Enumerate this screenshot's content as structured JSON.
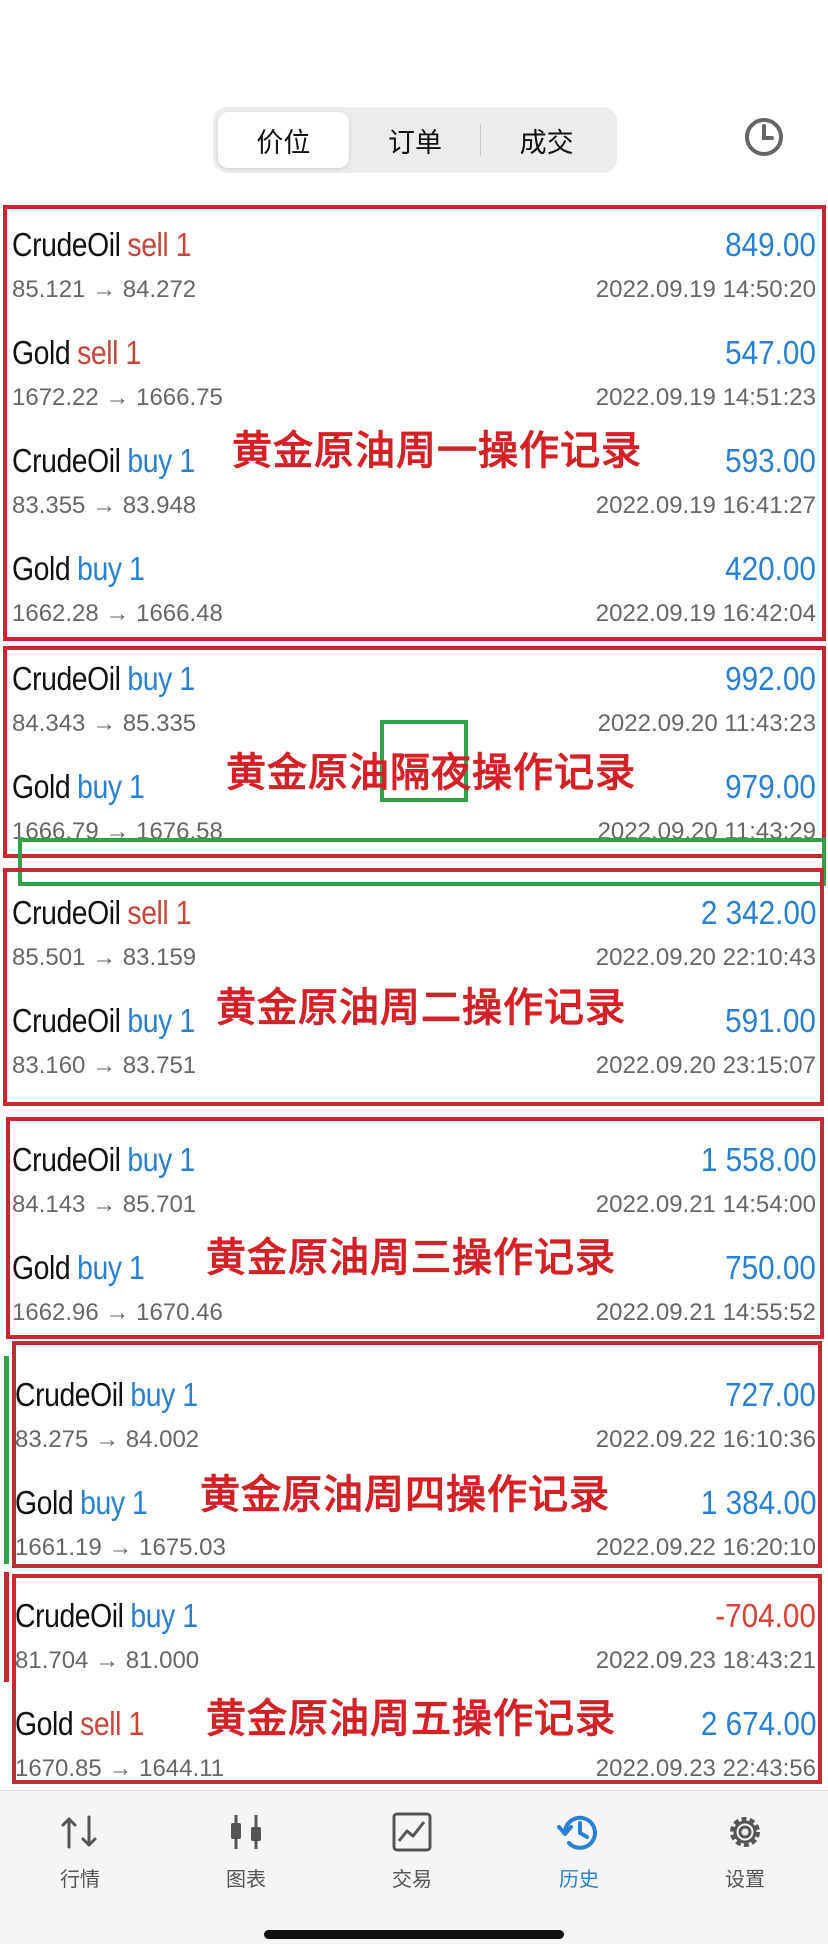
{
  "tabs": [
    "价位",
    "订单",
    "成交"
  ],
  "active_tab": 0,
  "header_icon": "clock-history-icon",
  "rows": [
    {
      "symbol": "CrudeOil",
      "side": "sell",
      "lots": "1",
      "profit": "849.00",
      "prices": "85.121 → 84.272",
      "time": "2022.09.19 14:50:20"
    },
    {
      "symbol": "Gold",
      "side": "sell",
      "lots": "1",
      "profit": "547.00",
      "prices": "1672.22 → 1666.75",
      "time": "2022.09.19 14:51:23"
    },
    {
      "symbol": "CrudeOil",
      "side": "buy",
      "lots": "1",
      "profit": "593.00",
      "prices": "83.355 → 83.948",
      "time": "2022.09.19 16:41:27"
    },
    {
      "symbol": "Gold",
      "side": "buy",
      "lots": "1",
      "profit": "420.00",
      "prices": "1662.28 → 1666.48",
      "time": "2022.09.19 16:42:04"
    },
    {
      "symbol": "CrudeOil",
      "side": "buy",
      "lots": "1",
      "profit": "992.00",
      "prices": "84.343 → 85.335",
      "time": "2022.09.20 11:43:23"
    },
    {
      "symbol": "Gold",
      "side": "buy",
      "lots": "1",
      "profit": "979.00",
      "prices": "1666.79 → 1676.58",
      "time": "2022.09.20 11:43:29"
    },
    {
      "symbol": "CrudeOil",
      "side": "sell",
      "lots": "1",
      "profit": "2 342.00",
      "prices": "85.501 → 83.159",
      "time": "2022.09.20 22:10:43"
    },
    {
      "symbol": "CrudeOil",
      "side": "buy",
      "lots": "1",
      "profit": "591.00",
      "prices": "83.160 → 83.751",
      "time": "2022.09.20 23:15:07"
    },
    {
      "symbol": "CrudeOil",
      "side": "buy",
      "lots": "1",
      "profit": "1 558.00",
      "prices": "84.143 → 85.701",
      "time": "2022.09.21 14:54:00"
    },
    {
      "symbol": "Gold",
      "side": "buy",
      "lots": "1",
      "profit": "750.00",
      "prices": "1662.96 → 1670.46",
      "time": "2022.09.21 14:55:52"
    },
    {
      "symbol": "CrudeOil",
      "side": "buy",
      "lots": "1",
      "profit": "727.00",
      "prices": "83.275 → 84.002",
      "time": "2022.09.22 16:10:36"
    },
    {
      "symbol": "Gold",
      "side": "buy",
      "lots": "1",
      "profit": "1 384.00",
      "prices": "1661.19 → 1675.03",
      "time": "2022.09.22 16:20:10"
    },
    {
      "symbol": "CrudeOil",
      "side": "buy",
      "lots": "1",
      "profit": "-704.00",
      "prices": "81.704 → 81.000",
      "time": "2022.09.23 18:43:21"
    },
    {
      "symbol": "Gold",
      "side": "sell",
      "lots": "1",
      "profit": "2 674.00",
      "prices": "1670.85 → 1644.11",
      "time": "2022.09.23 22:43:56"
    }
  ],
  "annotations": {
    "mon": "黄金原油周一操作记录",
    "overnight_pre": "黄金原油",
    "overnight_hl": "隔夜",
    "overnight_post": "操作记录",
    "tue": "黄金原油周二操作记录",
    "wed": "黄金原油周三操作记录",
    "thu": "黄金原油周四操作记录",
    "fri": "黄金原油周五操作记录"
  },
  "colors": {
    "sell": "#c8453a",
    "buy": "#2a7fd0",
    "loss": "#d8403a",
    "annotation": "#d42027",
    "highlight_green": "#2fa34a"
  },
  "tabbar": [
    {
      "label": "行情",
      "icon": "quotes-arrows-icon"
    },
    {
      "label": "图表",
      "icon": "candlestick-chart-icon"
    },
    {
      "label": "交易",
      "icon": "trade-chart-icon"
    },
    {
      "label": "历史",
      "icon": "history-clock-icon"
    },
    {
      "label": "设置",
      "icon": "settings-gear-icon"
    }
  ],
  "active_bottom_tab": 3
}
